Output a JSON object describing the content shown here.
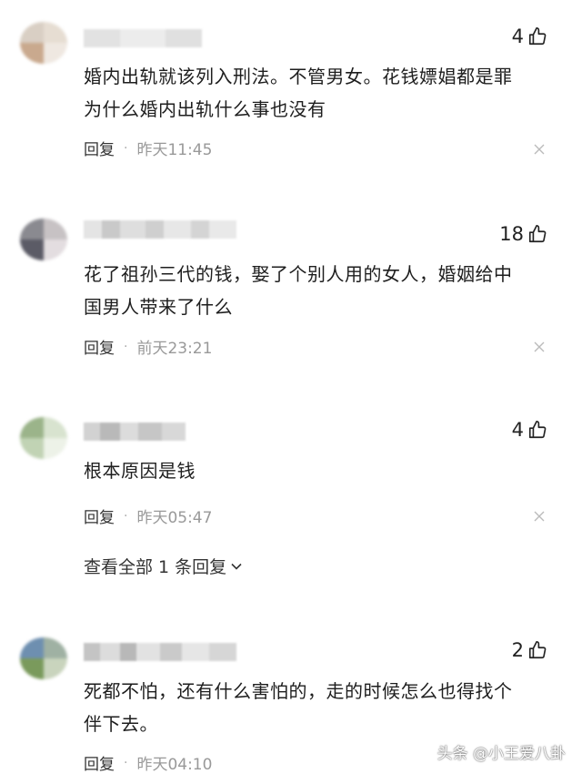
{
  "comments": [
    {
      "likes": "4",
      "lines": [
        "婚内出轨就该列入刑法。不管男女。花钱嫖娼都是罪",
        "为什么婚内出轨什么事也没有"
      ],
      "reply": "回复",
      "time": "昨天11:45"
    },
    {
      "likes": "18",
      "lines": [
        "花了祖孙三代的钱，娶了个别人用的女人，婚姻给中",
        "国男人带来了什么"
      ],
      "reply": "回复",
      "time": "前天23:21"
    },
    {
      "likes": "4",
      "lines": [
        "根本原因是钱"
      ],
      "reply": "回复",
      "time": "昨天05:47"
    },
    {
      "likes": "2",
      "lines": [
        "死都不怕，还有什么害怕的，走的时候怎么也得找个",
        "伴下去。"
      ],
      "reply": "回复",
      "time": "昨天04:10"
    }
  ],
  "view_all_replies": "查看全部 1 条回复",
  "watermark": "头条 @小王爱八卦",
  "icons": [
    "thumbs-up-icon",
    "close-icon",
    "chevron-down-icon"
  ],
  "colors": {
    "text": "#1e1e1e",
    "meta": "#999999",
    "icon": "#222222"
  }
}
